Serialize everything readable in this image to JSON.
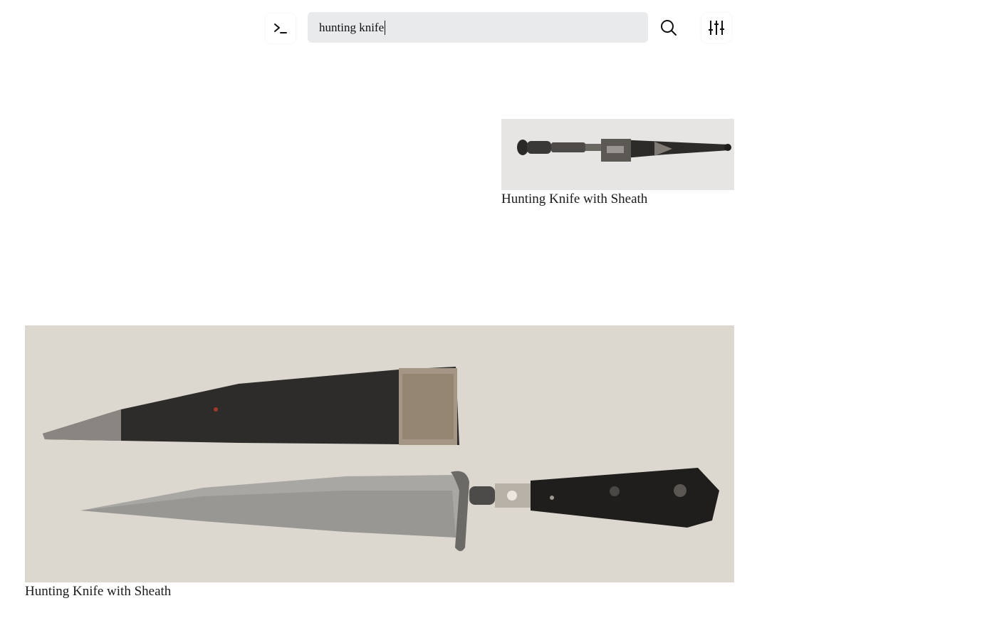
{
  "toolbar": {
    "terminal_icon": "terminal-prompt-icon",
    "search_value": "hunting knife",
    "search_icon": "magnifier-icon",
    "filter_icon": "sliders-icon"
  },
  "results": [
    {
      "caption": "Hunting Knife with Sheath",
      "image_subject": "sheathed knife, horizontal, dark handle and ornate metal sheath"
    },
    {
      "caption": "Hunting Knife with Sheath",
      "image_subject": "knife with steel blade and black handle above dark leather sheath"
    }
  ],
  "colors": {
    "search_bg": "#e9eaec",
    "image1_bg": "#e6e5e3",
    "image2_bg": "#dcd8d0"
  }
}
